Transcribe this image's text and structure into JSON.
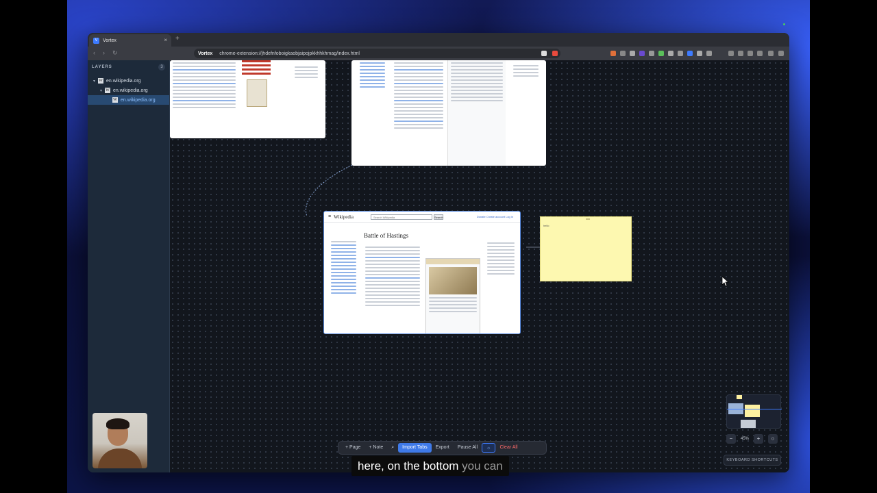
{
  "browser": {
    "tab_title": "Vortex",
    "tab_icon": "V",
    "site_label": "Vortex",
    "url": "chrome-extension://jhdefnfoboigkaobjaipojpkkhhkhmag/index.html"
  },
  "sidebar": {
    "heading": "LAYERS",
    "count": "3",
    "items": [
      {
        "label": "en.wikipedia.org",
        "icon": "W"
      },
      {
        "label": "en.wikipedia.org",
        "icon": "W"
      },
      {
        "label": "en.wikipedia.org",
        "icon": "W"
      }
    ]
  },
  "canvas": {
    "main_card": {
      "logo": "Wikipedia",
      "search_placeholder": "Search Wikipedia",
      "search_button": "Search",
      "title": "Battle of Hastings",
      "nav_right": "Donate  Create account  Log in"
    },
    "sticky_note": {
      "text": "hello"
    }
  },
  "toolbar": {
    "add_page": "+ Page",
    "add_note": "+ Note",
    "import_tabs": "Import Tabs",
    "export": "Export",
    "pause_all": "Pause All",
    "clear_all": "Clear All"
  },
  "zoom": {
    "minus": "−",
    "value": "45%",
    "plus": "+",
    "fit": "○"
  },
  "keyboard_shortcuts": "KEYBOARD SHORTCUTS",
  "caption": {
    "spoken": "here, on the bottom",
    "upcoming": "you can"
  },
  "colors": {
    "accent": "#3f7ae8",
    "danger": "#ff6b6b",
    "sticky": "#fdf8b0",
    "canvas": "#12161d"
  }
}
